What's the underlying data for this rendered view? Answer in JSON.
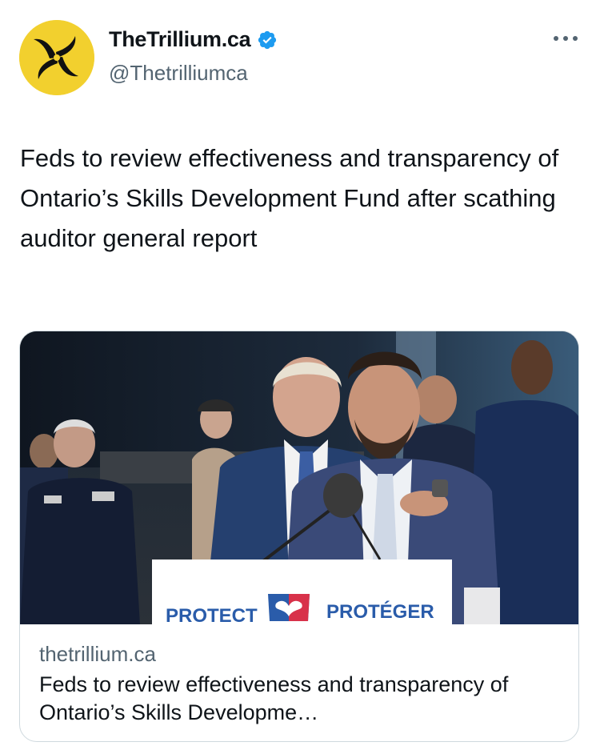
{
  "author": {
    "display_name": "TheTrillium.ca",
    "handle": "@Thetrilliumca",
    "verified": true,
    "avatar_color": "#f2d02e"
  },
  "tweet": {
    "text": "Feds to review effectiveness and transparency of Ontario’s Skills Development Fund after scathing auditor general report"
  },
  "card": {
    "domain": "thetrillium.ca",
    "title": "Feds to review effectiveness and transparency of Ontario’s Skills Developme…",
    "sign_left": "PROTECT",
    "sign_right": "PROTÉGER"
  },
  "icons": {
    "more": "more-horizontal-icon",
    "verified": "verified-badge-icon"
  },
  "colors": {
    "text": "#0f1419",
    "secondary": "#536471",
    "verified_blue": "#1d9bf0",
    "sign_blue": "#2a5caa"
  }
}
